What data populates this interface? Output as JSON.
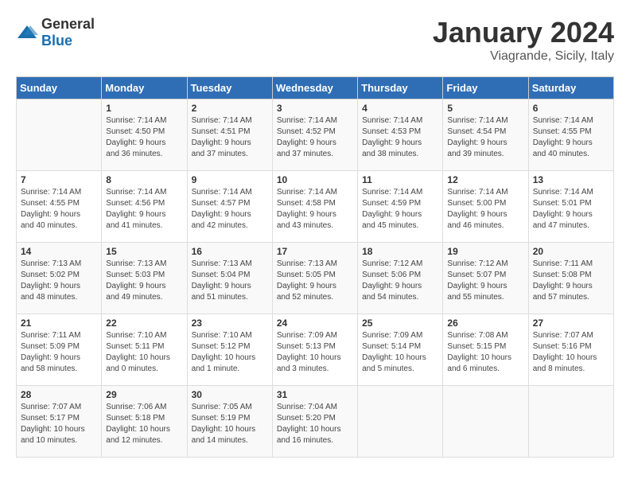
{
  "logo": {
    "general": "General",
    "blue": "Blue"
  },
  "title": {
    "month": "January 2024",
    "location": "Viagrande, Sicily, Italy"
  },
  "headers": [
    "Sunday",
    "Monday",
    "Tuesday",
    "Wednesday",
    "Thursday",
    "Friday",
    "Saturday"
  ],
  "weeks": [
    [
      {
        "day": "",
        "content": ""
      },
      {
        "day": "1",
        "content": "Sunrise: 7:14 AM\nSunset: 4:50 PM\nDaylight: 9 hours\nand 36 minutes."
      },
      {
        "day": "2",
        "content": "Sunrise: 7:14 AM\nSunset: 4:51 PM\nDaylight: 9 hours\nand 37 minutes."
      },
      {
        "day": "3",
        "content": "Sunrise: 7:14 AM\nSunset: 4:52 PM\nDaylight: 9 hours\nand 37 minutes."
      },
      {
        "day": "4",
        "content": "Sunrise: 7:14 AM\nSunset: 4:53 PM\nDaylight: 9 hours\nand 38 minutes."
      },
      {
        "day": "5",
        "content": "Sunrise: 7:14 AM\nSunset: 4:54 PM\nDaylight: 9 hours\nand 39 minutes."
      },
      {
        "day": "6",
        "content": "Sunrise: 7:14 AM\nSunset: 4:55 PM\nDaylight: 9 hours\nand 40 minutes."
      }
    ],
    [
      {
        "day": "7",
        "content": "Sunrise: 7:14 AM\nSunset: 4:55 PM\nDaylight: 9 hours\nand 40 minutes."
      },
      {
        "day": "8",
        "content": "Sunrise: 7:14 AM\nSunset: 4:56 PM\nDaylight: 9 hours\nand 41 minutes."
      },
      {
        "day": "9",
        "content": "Sunrise: 7:14 AM\nSunset: 4:57 PM\nDaylight: 9 hours\nand 42 minutes."
      },
      {
        "day": "10",
        "content": "Sunrise: 7:14 AM\nSunset: 4:58 PM\nDaylight: 9 hours\nand 43 minutes."
      },
      {
        "day": "11",
        "content": "Sunrise: 7:14 AM\nSunset: 4:59 PM\nDaylight: 9 hours\nand 45 minutes."
      },
      {
        "day": "12",
        "content": "Sunrise: 7:14 AM\nSunset: 5:00 PM\nDaylight: 9 hours\nand 46 minutes."
      },
      {
        "day": "13",
        "content": "Sunrise: 7:14 AM\nSunset: 5:01 PM\nDaylight: 9 hours\nand 47 minutes."
      }
    ],
    [
      {
        "day": "14",
        "content": "Sunrise: 7:13 AM\nSunset: 5:02 PM\nDaylight: 9 hours\nand 48 minutes."
      },
      {
        "day": "15",
        "content": "Sunrise: 7:13 AM\nSunset: 5:03 PM\nDaylight: 9 hours\nand 49 minutes."
      },
      {
        "day": "16",
        "content": "Sunrise: 7:13 AM\nSunset: 5:04 PM\nDaylight: 9 hours\nand 51 minutes."
      },
      {
        "day": "17",
        "content": "Sunrise: 7:13 AM\nSunset: 5:05 PM\nDaylight: 9 hours\nand 52 minutes."
      },
      {
        "day": "18",
        "content": "Sunrise: 7:12 AM\nSunset: 5:06 PM\nDaylight: 9 hours\nand 54 minutes."
      },
      {
        "day": "19",
        "content": "Sunrise: 7:12 AM\nSunset: 5:07 PM\nDaylight: 9 hours\nand 55 minutes."
      },
      {
        "day": "20",
        "content": "Sunrise: 7:11 AM\nSunset: 5:08 PM\nDaylight: 9 hours\nand 57 minutes."
      }
    ],
    [
      {
        "day": "21",
        "content": "Sunrise: 7:11 AM\nSunset: 5:09 PM\nDaylight: 9 hours\nand 58 minutes."
      },
      {
        "day": "22",
        "content": "Sunrise: 7:10 AM\nSunset: 5:11 PM\nDaylight: 10 hours\nand 0 minutes."
      },
      {
        "day": "23",
        "content": "Sunrise: 7:10 AM\nSunset: 5:12 PM\nDaylight: 10 hours\nand 1 minute."
      },
      {
        "day": "24",
        "content": "Sunrise: 7:09 AM\nSunset: 5:13 PM\nDaylight: 10 hours\nand 3 minutes."
      },
      {
        "day": "25",
        "content": "Sunrise: 7:09 AM\nSunset: 5:14 PM\nDaylight: 10 hours\nand 5 minutes."
      },
      {
        "day": "26",
        "content": "Sunrise: 7:08 AM\nSunset: 5:15 PM\nDaylight: 10 hours\nand 6 minutes."
      },
      {
        "day": "27",
        "content": "Sunrise: 7:07 AM\nSunset: 5:16 PM\nDaylight: 10 hours\nand 8 minutes."
      }
    ],
    [
      {
        "day": "28",
        "content": "Sunrise: 7:07 AM\nSunset: 5:17 PM\nDaylight: 10 hours\nand 10 minutes."
      },
      {
        "day": "29",
        "content": "Sunrise: 7:06 AM\nSunset: 5:18 PM\nDaylight: 10 hours\nand 12 minutes."
      },
      {
        "day": "30",
        "content": "Sunrise: 7:05 AM\nSunset: 5:19 PM\nDaylight: 10 hours\nand 14 minutes."
      },
      {
        "day": "31",
        "content": "Sunrise: 7:04 AM\nSunset: 5:20 PM\nDaylight: 10 hours\nand 16 minutes."
      },
      {
        "day": "",
        "content": ""
      },
      {
        "day": "",
        "content": ""
      },
      {
        "day": "",
        "content": ""
      }
    ]
  ]
}
